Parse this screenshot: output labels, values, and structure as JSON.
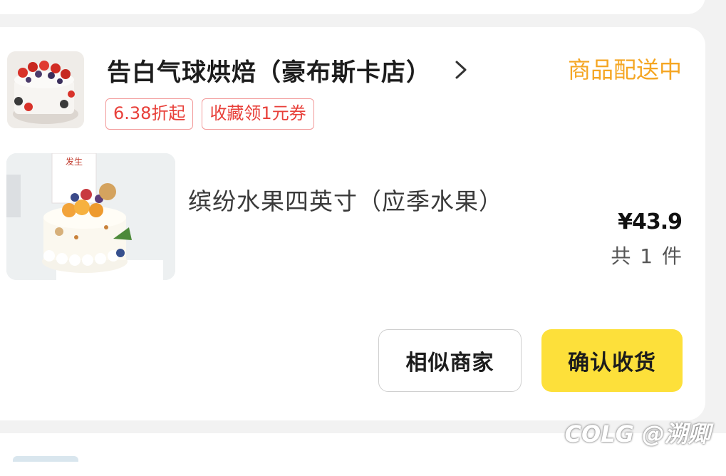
{
  "shop": {
    "name": "告白气球烘焙（豪布斯卡店）",
    "status": "商品配送中",
    "tags": [
      "6.38折起",
      "收藏领1元券"
    ]
  },
  "item": {
    "name": "缤纷水果四英寸（应季水果）",
    "price": "¥43.9",
    "quantity": "共 1 件",
    "image_text": "发生"
  },
  "actions": {
    "similar_label": "相似商家",
    "confirm_label": "确认收货"
  },
  "watermark": "COLG @溯卿",
  "colors": {
    "status": "#f5a623",
    "tag": "#e8403a",
    "confirm_button": "#fde03a"
  }
}
